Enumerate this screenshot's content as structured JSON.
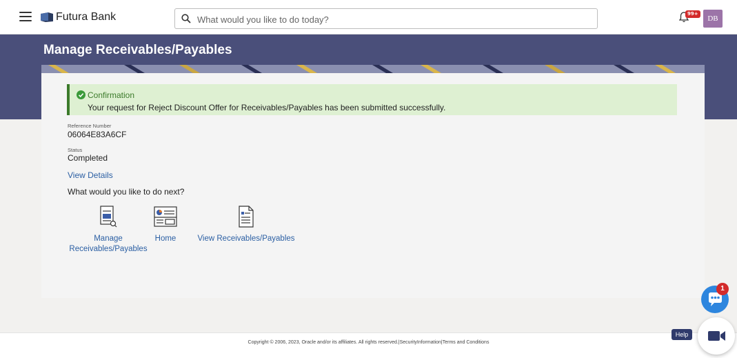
{
  "header": {
    "brand": "Futura Bank",
    "search_placeholder": "What would you like to do today?",
    "notification_count": "99+",
    "avatar_initials": "DB"
  },
  "page": {
    "title": "Manage Receivables/Payables"
  },
  "confirmation": {
    "title": "Confirmation",
    "message": "Your request for Reject Discount Offer for Receivables/Payables has been submitted successfully."
  },
  "details": {
    "reference_label": "Reference Number",
    "reference_value": "06064E83A6CF",
    "status_label": "Status",
    "status_value": "Completed",
    "view_details": "View Details"
  },
  "next": {
    "question": "What would you like to do next?",
    "actions": [
      {
        "label_line1": "Manage",
        "label_line2": "Receivables/Payables",
        "icon": "document-search-icon"
      },
      {
        "label_line1": "Home",
        "label_line2": "",
        "icon": "dashboard-icon"
      },
      {
        "label_line1": "View Receivables/Payables",
        "label_line2": "",
        "icon": "document-list-icon"
      }
    ]
  },
  "footer": {
    "copyright": "Copyright © 2006, 2023, Oracle and/or its affiliates. All rights reserved.|SecurityInformation|Terms and Conditions"
  },
  "widgets": {
    "chat_badge": "1",
    "help_label": "Help"
  },
  "colors": {
    "banner": "#4a4f7a",
    "success_bg": "#def0d2",
    "success_accent": "#3b7a2a",
    "link": "#2b5fa3",
    "chat": "#2e86de"
  }
}
